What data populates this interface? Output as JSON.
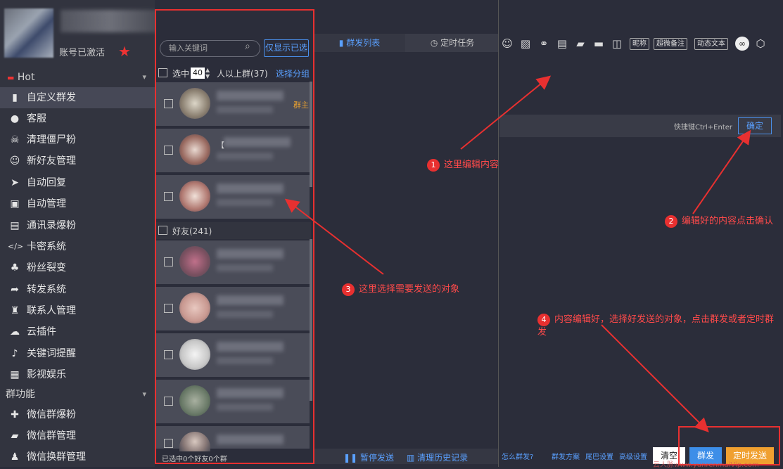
{
  "window": {
    "minimize": "—",
    "maximize": "☐",
    "close": "✕"
  },
  "profile": {
    "status": "账号已激活"
  },
  "nav": {
    "group_hot": "Hot",
    "items": [
      "自定义群发",
      "客服",
      "清理僵尸粉",
      "新好友管理",
      "自动回复",
      "自动管理",
      "通讯录爆粉",
      "卡密系统",
      "粉丝裂变",
      "转发系统",
      "联系人管理",
      "云插件",
      "关键词提醒",
      "影视娱乐"
    ],
    "group_qun": "群功能",
    "items2": [
      "微信群爆粉",
      "微信群管理",
      "微信换群管理"
    ]
  },
  "grouplist": {
    "search_placeholder": "输入关键词",
    "only_selected": "仅显示已选",
    "select_prefix": "选中",
    "select_num": "40",
    "select_suffix": "人以上群(37)",
    "select_group": "选择分组",
    "owner_badge": "群主",
    "row2_text": "【",
    "row3_text": "",
    "friends_header": "好友(241)",
    "footer": "已选中0个好友0个群"
  },
  "middle": {
    "tab_list": "群发列表",
    "tab_timed": "定时任务",
    "pause": "暂停发送",
    "clear_history": "清理历史记录"
  },
  "right": {
    "tool_nick": "昵称",
    "tool_super": "超微备注",
    "tool_dynamic": "动态文本",
    "shortcut": "快捷键Ctrl+Enter",
    "confirm": "确定",
    "how": "怎么群发?",
    "plan": "群发方案",
    "tail": "尾巴设置",
    "advanced": "高级设置",
    "clear": "清空",
    "send": "群发",
    "timed_send": "定时发送"
  },
  "annotations": {
    "a1_num": "1",
    "a1": "这里编辑内容",
    "a2_num": "2",
    "a2": "编辑好的内容点击确认",
    "a3_num": "3",
    "a3": "这里选择需要发送的对象",
    "a4_num": "4",
    "a4": "内容编辑好，选择好发送的对象，点击群发或者定时群发"
  },
  "watermark": "云人脉www.yunrenmaiVip.com"
}
